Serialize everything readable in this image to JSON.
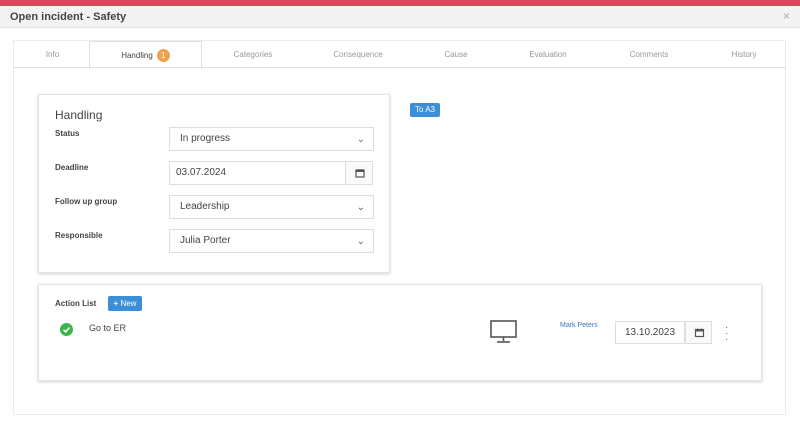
{
  "window": {
    "title": "Open incident - Safety",
    "close_glyph": "×"
  },
  "tabs": [
    {
      "label": "Info"
    },
    {
      "label": "Handling",
      "badge": "1",
      "active": true
    },
    {
      "label": "Categories"
    },
    {
      "label": "Consequence"
    },
    {
      "label": "Cause"
    },
    {
      "label": "Evaluation"
    },
    {
      "label": "Comments"
    },
    {
      "label": "History"
    }
  ],
  "handling": {
    "title": "Handling",
    "status": {
      "label": "Status",
      "value": "In progress"
    },
    "deadline": {
      "label": "Deadline",
      "value": "03.07.2024"
    },
    "follow_up_group": {
      "label": "Follow up group",
      "value": "Leadership"
    },
    "responsible": {
      "label": "Responsible",
      "value": "Julia Porter"
    }
  },
  "to_a3_label": "To A3",
  "action_list": {
    "label": "Action List",
    "new_label": "New",
    "new_glyph": "+",
    "items": [
      {
        "text": "Go to ER",
        "assignee": "Mark Peters",
        "date": "13.10.2023",
        "status": "done",
        "status_color": "#3bb54a"
      }
    ]
  },
  "colors": {
    "accent": "#3b8fd8",
    "top_bar": "#d24c5c",
    "badge": "#f0a24b",
    "success": "#3bb54a"
  },
  "icons": [
    "close-icon",
    "chevron-down-icon",
    "calendar-icon",
    "plus-icon",
    "check-circle-icon",
    "monitor-icon",
    "kebab-menu-icon"
  ]
}
